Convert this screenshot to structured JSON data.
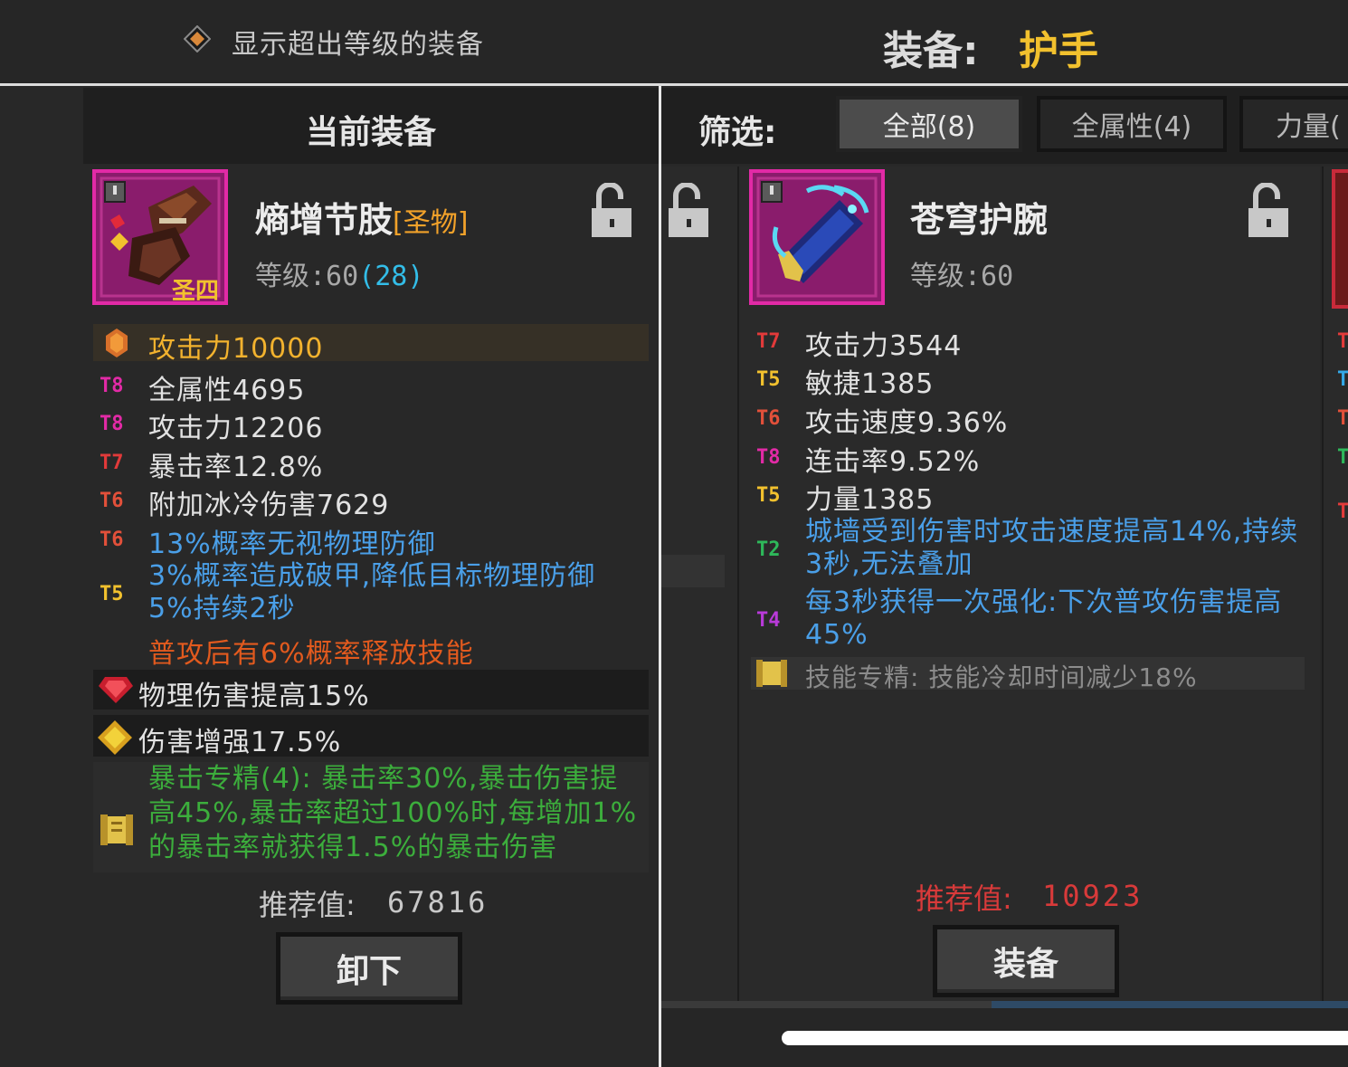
{
  "header": {
    "toggle_label": "显示超出等级的装备",
    "title_label": "装备:",
    "title_value": "护手"
  },
  "current": {
    "section_title": "当前装备",
    "name": "熵增节肢",
    "tag": "[圣物]",
    "badge": "圣四",
    "level_label": "等级:60",
    "level_extra": "(28)",
    "main_stat": "攻击力10000",
    "stats": [
      {
        "tier": "T8",
        "text": "全属性4695"
      },
      {
        "tier": "T8",
        "text": "攻击力12206"
      },
      {
        "tier": "T7",
        "text": "暴击率12.8%"
      },
      {
        "tier": "T6",
        "text": "附加冰冷伤害7629"
      },
      {
        "tier": "T6",
        "text": "13%概率无视物理防御"
      },
      {
        "tier": "T5",
        "text": "3%概率造成破甲,降低目标物理防御5%持续2秒"
      }
    ],
    "special_effect": "普攻后有6%概率释放技能",
    "gems": [
      {
        "icon": "ruby-gem-icon",
        "text": "物理伤害提高15%"
      },
      {
        "icon": "topaz-gem-icon",
        "text": "伤害增强17.5%"
      }
    ],
    "mastery": "暴击专精(4): 暴击率30%,暴击伤害提高45%,暴击率超过100%时,每增加1%的暴击率就获得1.5%的暴击伤害",
    "recommend_label": "推荐值:",
    "recommend_value": "67816",
    "button_label": "卸下"
  },
  "filter": {
    "label": "筛选:",
    "tabs": [
      "全部(8)",
      "全属性(4)",
      "力量("
    ]
  },
  "candidate": {
    "name": "苍穹护腕",
    "level_label": "等级:60",
    "stats": [
      {
        "tier": "T7",
        "text": "攻击力3544"
      },
      {
        "tier": "T5",
        "text": "敏捷1385"
      },
      {
        "tier": "T6",
        "text": "攻击速度9.36%"
      },
      {
        "tier": "T8",
        "text": "连击率9.52%"
      },
      {
        "tier": "T5",
        "text": "力量1385"
      },
      {
        "tier": "T2",
        "text": "城墙受到伤害时攻击速度提高14%,持续3秒,无法叠加"
      },
      {
        "tier": "T4",
        "text": "每3秒获得一次强化:下次普攻伤害提高45%"
      }
    ],
    "mastery": "技能专精: 技能冷却时间减少18%",
    "recommend_label": "推荐值:",
    "recommend_value": "10923",
    "button_label": "装备"
  },
  "peek_tiers": [
    "T",
    "T",
    "T",
    "T",
    "T"
  ],
  "colors": {
    "legendary_frame": "#e22aa6",
    "gold": "#f2c12e",
    "blue_text": "#4a9fe8",
    "red_text": "#e25a1e",
    "green_text": "#3cae3c",
    "recommend_red": "#d83a3a"
  }
}
